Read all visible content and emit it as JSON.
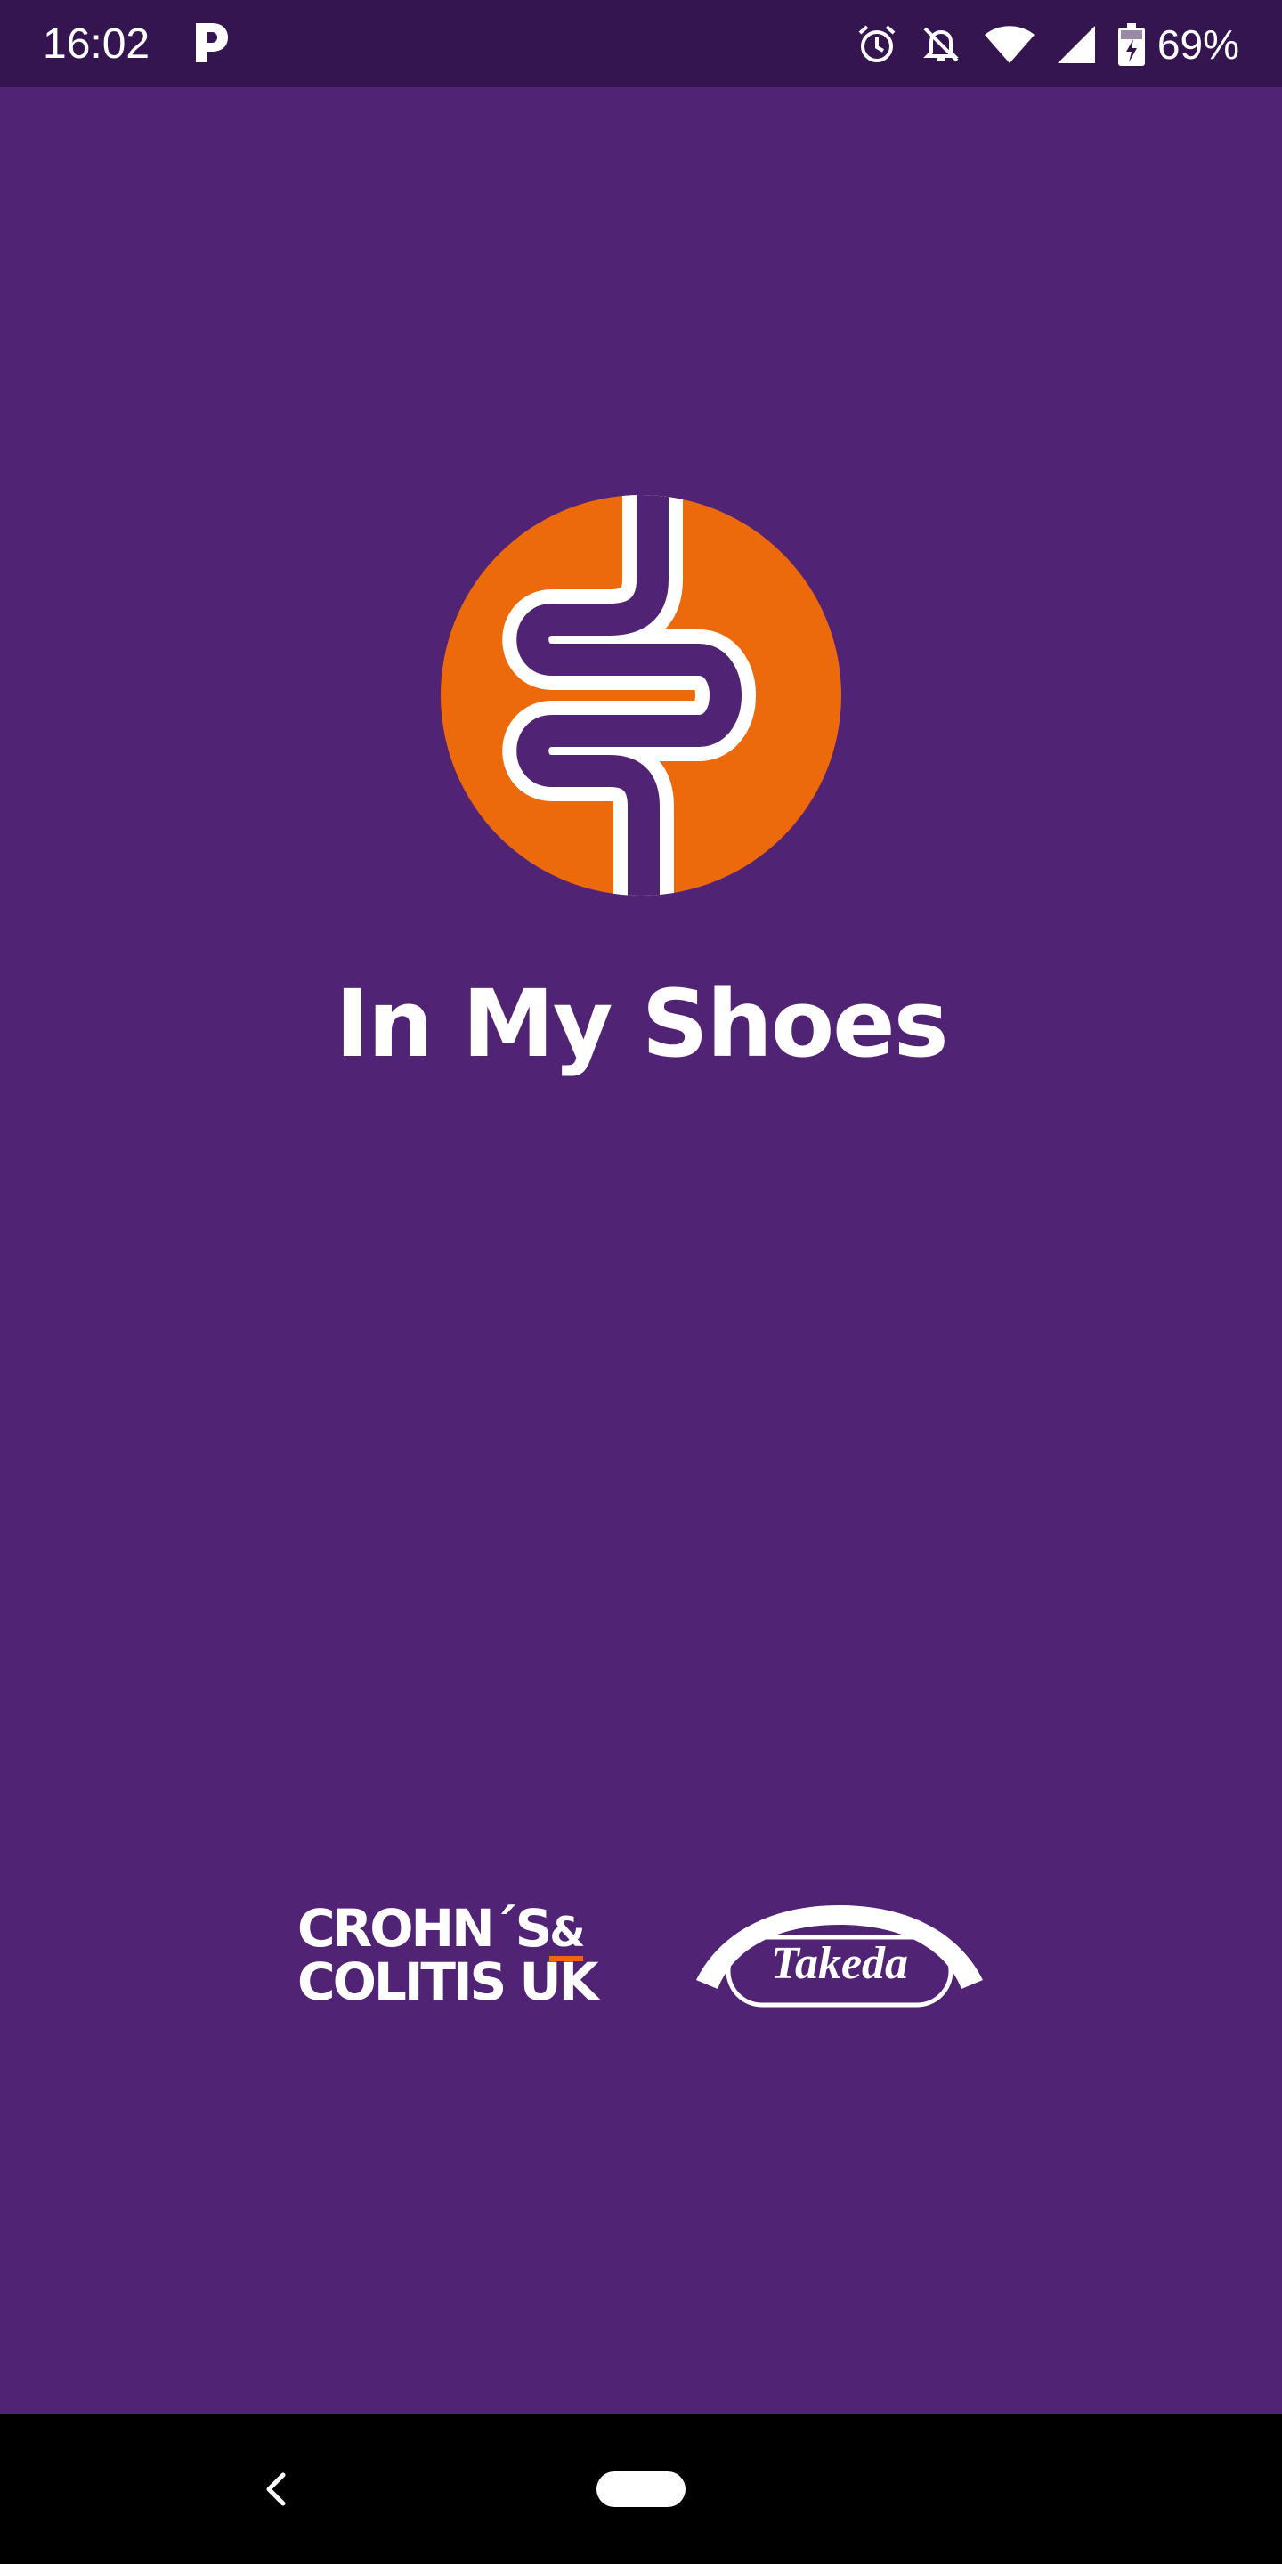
{
  "status_bar": {
    "time": "16:02",
    "app_icon": "parking-p-icon",
    "icons": [
      "alarm-icon",
      "notifications-off-icon",
      "wifi-icon",
      "cell-signal-icon",
      "battery-charging-icon"
    ],
    "battery_percent": "69%"
  },
  "app": {
    "logo_icon": "intestine-logo-icon",
    "title": "In My Shoes",
    "brand_color": "#512375",
    "accent_color": "#ec6a0c"
  },
  "partners": {
    "ccuk_line1": "CROHN´S",
    "ccuk_amp": "&",
    "ccuk_line2": "COLITIS UK",
    "takeda": "Takeda"
  },
  "nav_bar": {
    "back_icon": "back-chevron-icon",
    "home_icon": "home-pill-icon"
  }
}
